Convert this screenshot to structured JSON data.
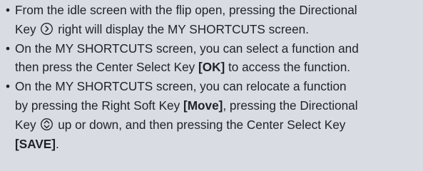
{
  "bullets": [
    {
      "lines": [
        {
          "pre": "From the idle screen with the flip open, pressing the Directional"
        },
        {
          "pre": "Key",
          "icon": "directional-right-icon",
          "post": "right will display the MY SHORTCUTS screen."
        }
      ]
    },
    {
      "lines": [
        {
          "pre": "On the MY SHORTCUTS screen, you can select a function and"
        },
        {
          "pre": "then press the Center Select Key ",
          "bold": "[OK]",
          "post": " to access the function."
        }
      ]
    },
    {
      "lines": [
        {
          "pre": "On the MY SHORTCUTS screen, you can relocate a function"
        },
        {
          "pre": "by pressing the Right Soft Key ",
          "bold": "[Move]",
          "post": ", pressing the Directional"
        },
        {
          "pre": "Key",
          "icon": "directional-up-down-icon",
          "post": "up or down, and then pressing the Center Select Key"
        },
        {
          "bold": "[SAVE]",
          "post": "."
        }
      ]
    }
  ],
  "bullet_glyph": "•"
}
